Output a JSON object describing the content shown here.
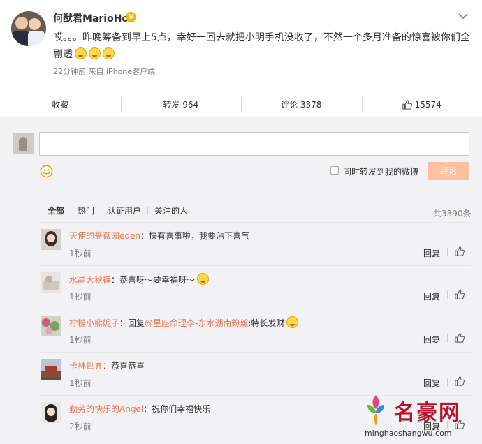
{
  "post": {
    "author": "何猷君MarioHo",
    "verified_badge": "V",
    "text": "哎。。。昨晚筹备到早上5点，幸好一回去就把小明手机没收了，不然一个多月准备的惊喜被你们全剧透",
    "time": "22分钟前",
    "source": "来自 iPhone客户端"
  },
  "actions": {
    "favorite": "收藏",
    "repost": "转发 964",
    "comment": "评论 3378",
    "like": "15574"
  },
  "composer": {
    "repost_label": "同时转发到我的微博",
    "submit_label": "评论"
  },
  "filters": [
    "全部",
    "热门",
    "认证用户",
    "关注的人"
  ],
  "total_comments": "共3390条",
  "comments": [
    {
      "name": "天使的蔷薇园eden",
      "text": "：快有喜事啦，我要沾下喜气",
      "time": "1秒前",
      "reply": "回复"
    },
    {
      "name": "水晶大秋裤",
      "text": "：恭喜呀～要幸福呀～",
      "time": "1秒前",
      "reply": "回复"
    },
    {
      "name": "柠檬小熊妮子",
      "text": "：回复",
      "at": "@星座命理李-东水湖南粉丝",
      "text2": ":特长发财",
      "time": "1秒前",
      "reply": "回复"
    },
    {
      "name": "卡林世界",
      "text": "：恭喜恭喜",
      "time": "1秒前",
      "reply": "回复"
    },
    {
      "name": "勤劳的快乐的Angel",
      "text": "：祝你们幸福快乐",
      "time": "2秒前",
      "reply": "回复"
    }
  ],
  "watermark": {
    "title": "名豪网",
    "url": "minghaoshangwu.com"
  },
  "colors": {
    "accent": "#eb7350",
    "submit_disabled": "#ffc09f",
    "badge": "#f7b500",
    "watermark": "#b5122c"
  }
}
